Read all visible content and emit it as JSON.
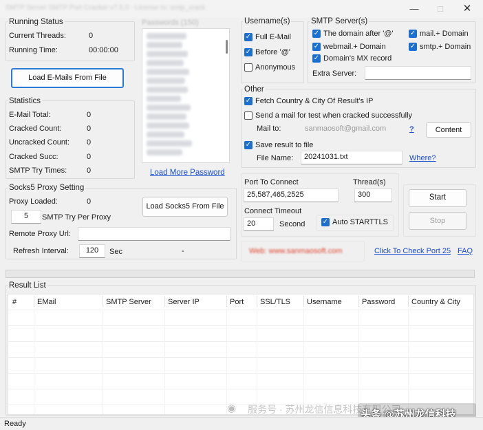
{
  "window": {
    "title": "SMTP Server SMTP Port Cracker v7.5.0 - License to: smtp_crack"
  },
  "running_status": {
    "title": "Running Status",
    "threads_label": "Current Threads:",
    "threads_value": "0",
    "time_label": "Running Time:",
    "time_value": "00:00:00"
  },
  "passwords": {
    "title": "Passwords (150)",
    "load_more": "Load More Password"
  },
  "load_emails_button": "Load E-Mails From File",
  "statistics": {
    "title": "Statistics",
    "rows": [
      {
        "label": "E-Mail Total:",
        "value": "0"
      },
      {
        "label": "Cracked Count:",
        "value": "0"
      },
      {
        "label": "Uncracked Count:",
        "value": "0"
      },
      {
        "label": "Cracked Succ:",
        "value": "0"
      },
      {
        "label": "SMTP Try Times:",
        "value": "0"
      }
    ]
  },
  "socks5": {
    "title": "Socks5 Proxy Setting",
    "loaded_label": "Proxy Loaded:",
    "loaded_value": "0",
    "load_button": "Load Socks5 From File",
    "try_value": "5",
    "try_label": "SMTP Try Per Proxy",
    "remote_label": "Remote Proxy Url:",
    "remote_value": "",
    "refresh_label": "Refresh Interval:",
    "refresh_value": "120",
    "refresh_unit": "Sec",
    "dash": "-"
  },
  "username": {
    "title": "Username(s)",
    "options": [
      {
        "label": "Full E-Mail",
        "checked": true
      },
      {
        "label": "Before '@'",
        "checked": true
      },
      {
        "label": "Anonymous",
        "checked": false
      }
    ]
  },
  "smtp_servers": {
    "title": "SMTP Server(s)",
    "opt1": {
      "label": "The domain after '@'",
      "checked": true
    },
    "opt2": {
      "label": "mail.+ Domain",
      "checked": true
    },
    "opt3": {
      "label": "webmail.+ Domain",
      "checked": true
    },
    "opt4": {
      "label": "smtp.+ Domain",
      "checked": true
    },
    "opt5": {
      "label": "Domain's MX record",
      "checked": true
    },
    "extra_label": "Extra Server:",
    "extra_value": ""
  },
  "other": {
    "title": "Other",
    "fetch_country": {
      "label": "Fetch Country & City Of Result's IP",
      "checked": true
    },
    "send_test": {
      "label": "Send a mail for test when cracked successfully",
      "checked": false
    },
    "mail_to_label": "Mail to:",
    "mail_to_value": "sanmaosoft@gmail.com",
    "help": "?",
    "content_button": "Content",
    "save_result": {
      "label": "Save result to file",
      "checked": true
    },
    "file_name_label": "File Name:",
    "file_name_value": "20241031.txt",
    "where_link": "Where?"
  },
  "port": {
    "label": "Port To Connect",
    "value": "25,587,465,2525",
    "threads_label": "Thread(s)",
    "threads_value": "300",
    "timeout_label": "Connect Timeout",
    "timeout_value": "20",
    "timeout_unit": "Second",
    "auto_starttls": {
      "label": "Auto STARTTLS",
      "checked": true
    }
  },
  "actions": {
    "start": "Start",
    "stop": "Stop"
  },
  "links": {
    "web": "Web: www.sanmaosoft.com",
    "check_port": "Click To Check Port 25",
    "faq": "FAQ"
  },
  "progress": 0,
  "result_list": {
    "title": "Result List",
    "columns": [
      "#",
      "EMail",
      "SMTP Server",
      "Server IP",
      "Port",
      "SSL/TLS",
      "Username",
      "Password",
      "Country & City"
    ]
  },
  "watermark": {
    "text1": "服务号 · 苏州龙信信息科技有限公司",
    "text2": "头条 @苏州龙信科技"
  },
  "status": "Ready",
  "colors": {
    "accent": "#1a6fd0",
    "link": "#1a4fd0",
    "web_link": "#e0442e"
  }
}
